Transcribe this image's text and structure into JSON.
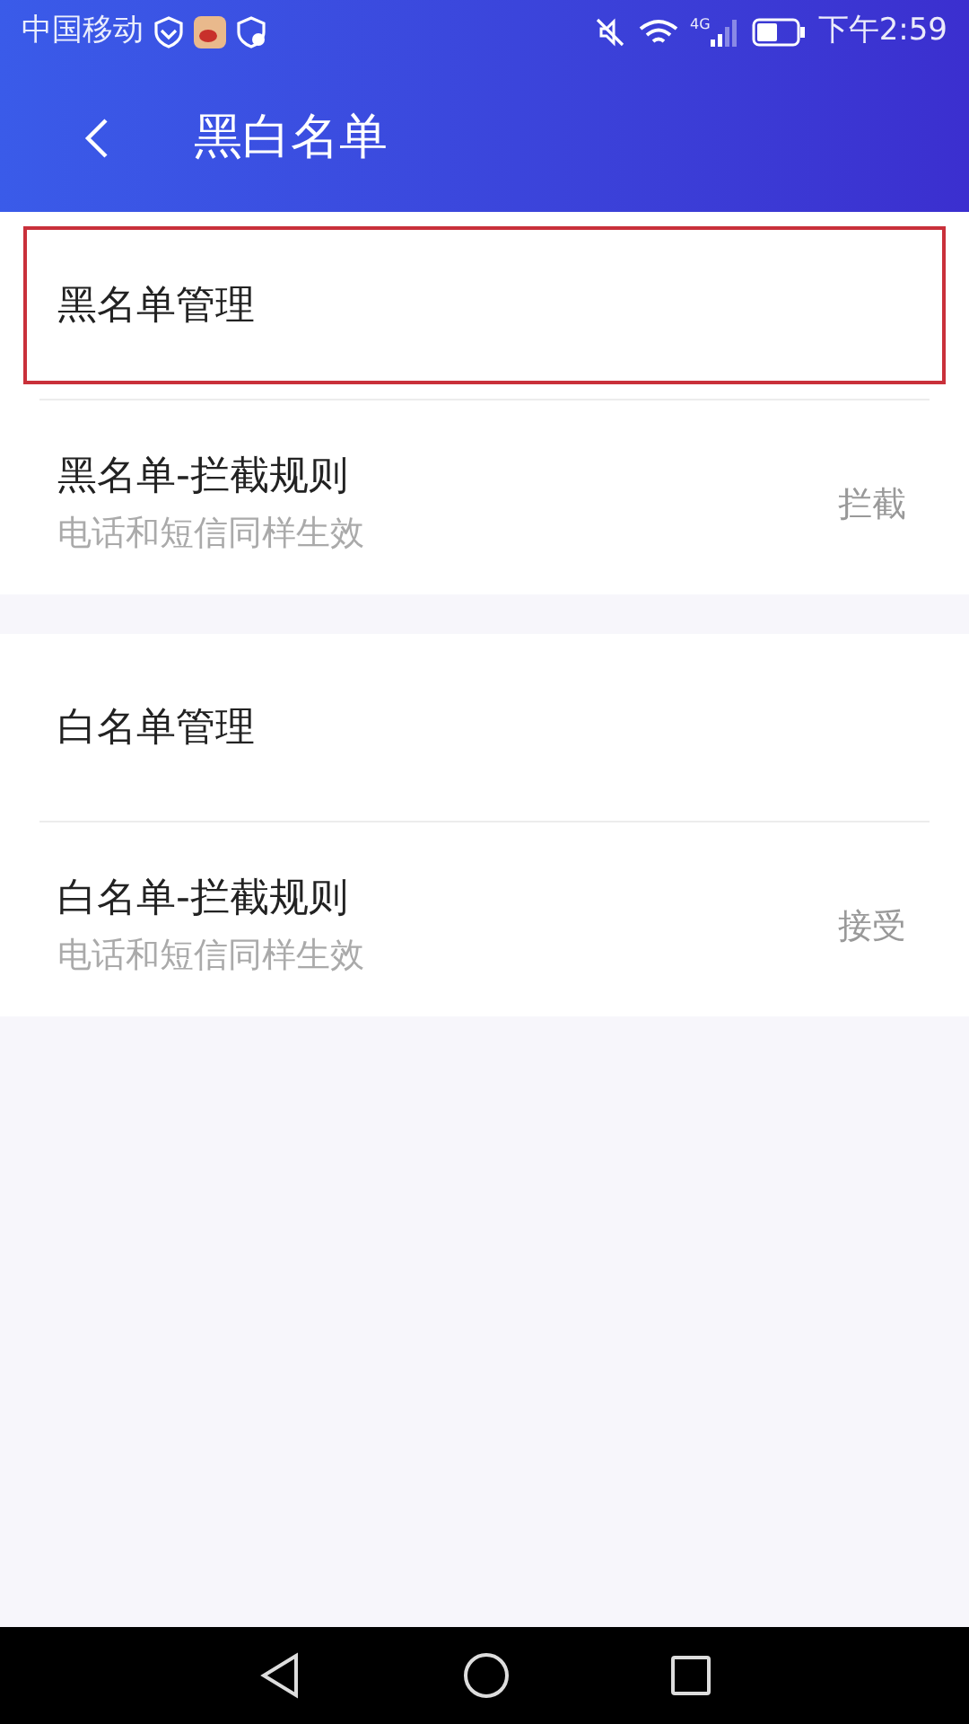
{
  "status_bar": {
    "carrier": "中国移动",
    "network": "4G",
    "time": "下午2:59"
  },
  "header": {
    "title": "黑白名单"
  },
  "sections": [
    {
      "items": [
        {
          "kind": "link",
          "title": "黑名单管理",
          "highlighted": true
        },
        {
          "kind": "rule",
          "title": "黑名单-拦截规则",
          "subtitle": "电话和短信同样生效",
          "value": "拦截",
          "highlighted": false
        }
      ]
    },
    {
      "items": [
        {
          "kind": "link",
          "title": "白名单管理",
          "highlighted": false
        },
        {
          "kind": "rule",
          "title": "白名单-拦截规则",
          "subtitle": "电话和短信同样生效",
          "value": "接受",
          "highlighted": false
        }
      ]
    }
  ]
}
